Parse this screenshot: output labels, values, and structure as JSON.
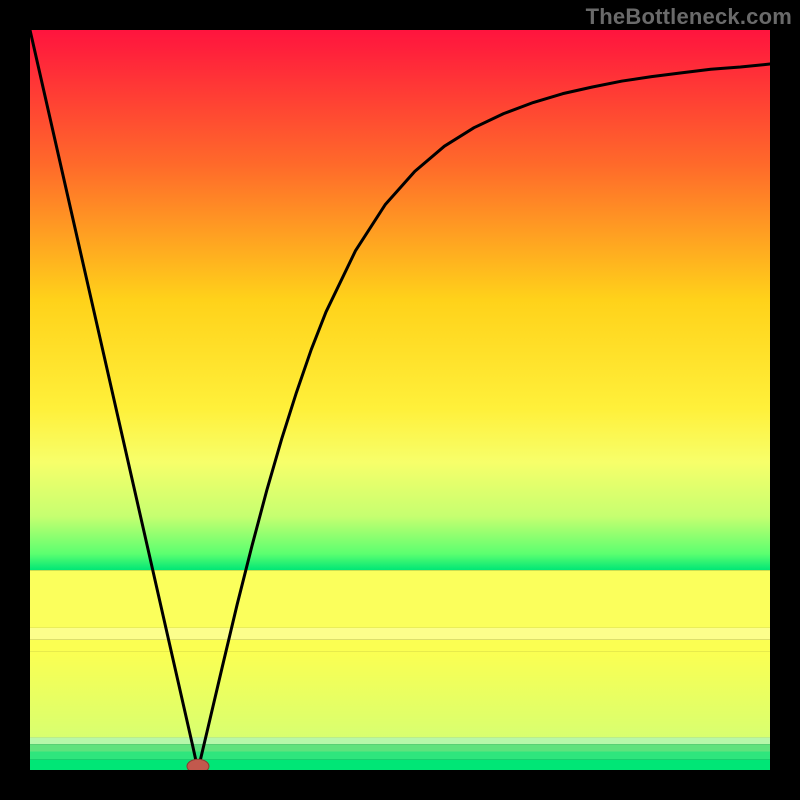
{
  "watermark": "TheBottleneck.com",
  "chart_data": {
    "type": "line",
    "title": "",
    "xlabel": "",
    "ylabel": "",
    "xlim": [
      0,
      1
    ],
    "ylim": [
      0,
      1
    ],
    "x": [
      0.0,
      0.02,
      0.04,
      0.06,
      0.08,
      0.1,
      0.12,
      0.14,
      0.16,
      0.18,
      0.2,
      0.22,
      0.227,
      0.24,
      0.26,
      0.28,
      0.3,
      0.32,
      0.34,
      0.36,
      0.38,
      0.4,
      0.44,
      0.48,
      0.52,
      0.56,
      0.6,
      0.64,
      0.68,
      0.72,
      0.76,
      0.8,
      0.84,
      0.88,
      0.92,
      0.96,
      1.0
    ],
    "values": [
      1.0,
      0.912,
      0.824,
      0.736,
      0.648,
      0.56,
      0.472,
      0.384,
      0.296,
      0.208,
      0.12,
      0.032,
      0.0,
      0.055,
      0.14,
      0.224,
      0.303,
      0.378,
      0.447,
      0.51,
      0.568,
      0.619,
      0.702,
      0.764,
      0.809,
      0.843,
      0.868,
      0.887,
      0.902,
      0.914,
      0.923,
      0.931,
      0.937,
      0.942,
      0.947,
      0.95,
      0.954
    ],
    "marker": {
      "x": 0.227,
      "y": 0.005,
      "color": "#c2594d"
    },
    "gradient_stops": [
      {
        "offset": 0.0,
        "color": "#ff143e"
      },
      {
        "offset": 0.25,
        "color": "#ff6a2a"
      },
      {
        "offset": 0.5,
        "color": "#ffd21a"
      },
      {
        "offset": 0.7,
        "color": "#fff03a"
      },
      {
        "offset": 0.8,
        "color": "#f7ff6a"
      },
      {
        "offset": 0.9,
        "color": "#c6ff70"
      },
      {
        "offset": 0.97,
        "color": "#5bff70"
      },
      {
        "offset": 1.0,
        "color": "#00e676"
      }
    ],
    "background_bands": [
      {
        "y0": 0.0,
        "y1": 0.73,
        "type": "gradient"
      },
      {
        "y0": 0.73,
        "y1": 0.808,
        "color": "#fbff5c"
      },
      {
        "y0": 0.808,
        "y1": 0.824,
        "color": "#fcfe8c"
      },
      {
        "y0": 0.824,
        "y1": 0.84,
        "color": "#fbff52"
      },
      {
        "y0": 0.84,
        "y1": 0.956,
        "type": "gradient2"
      },
      {
        "y0": 0.956,
        "y1": 0.965,
        "color": "#b7f7aa"
      },
      {
        "y0": 0.965,
        "y1": 0.975,
        "color": "#60e27d"
      },
      {
        "y0": 0.975,
        "y1": 0.986,
        "color": "#2fe57d"
      },
      {
        "y0": 0.986,
        "y1": 1.0,
        "color": "#00e676"
      }
    ]
  }
}
